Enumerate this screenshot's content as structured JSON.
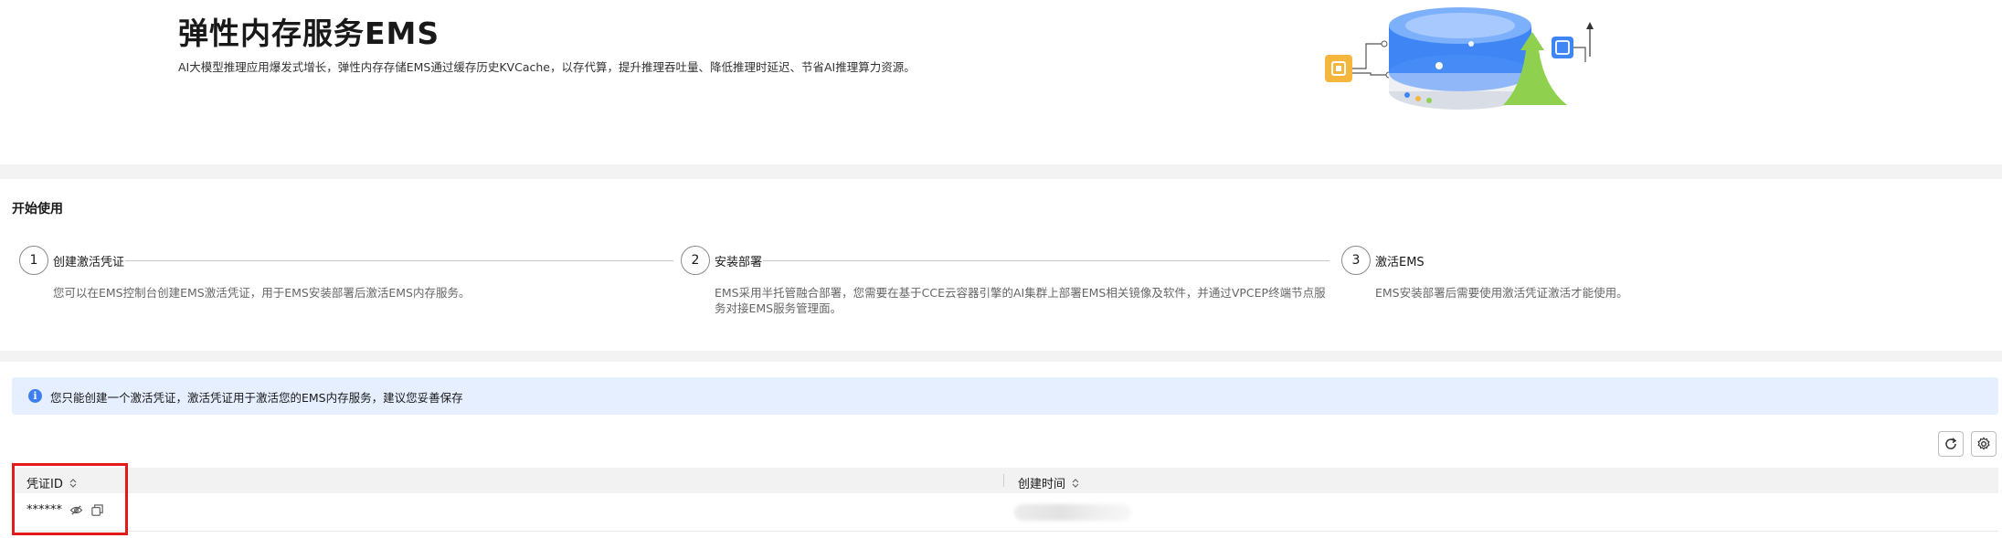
{
  "header": {
    "title": "弹性内存服务EMS",
    "subtitle": "AI大模型推理应用爆发式增长，弹性内存存储EMS通过缓存历史KVCache，以存代算，提升推理吞吐量、降低推理时延迟、节省AI推理算力资源。"
  },
  "start": {
    "title": "开始使用",
    "steps": [
      {
        "num": "1",
        "label": "创建激活凭证",
        "desc": "您可以在EMS控制台创建EMS激活凭证，用于EMS安装部署后激活EMS内存服务。"
      },
      {
        "num": "2",
        "label": "安装部署",
        "desc": "EMS采用半托管融合部署，您需要在基于CCE云容器引擎的AI集群上部署EMS相关镜像及软件，并通过VPCEP终端节点服务对接EMS服务管理面。"
      },
      {
        "num": "3",
        "label": "激活EMS",
        "desc": "EMS安装部署后需要使用激活凭证激活才能使用。"
      }
    ]
  },
  "info": {
    "icon": "info-icon",
    "text": "您只能创建一个激活凭证，激活凭证用于激活您的EMS内存服务，建议您妥善保存"
  },
  "toolbar": {
    "refresh_icon": "refresh-icon",
    "settings_icon": "gear-icon"
  },
  "table": {
    "columns": [
      "凭证ID",
      "创建时间"
    ],
    "rows": [
      {
        "credential_id": "******",
        "created_time": ""
      }
    ]
  },
  "colors": {
    "accent": "#3c7ff0",
    "info_bg": "#e6efff",
    "highlight": "#e21a1a"
  }
}
